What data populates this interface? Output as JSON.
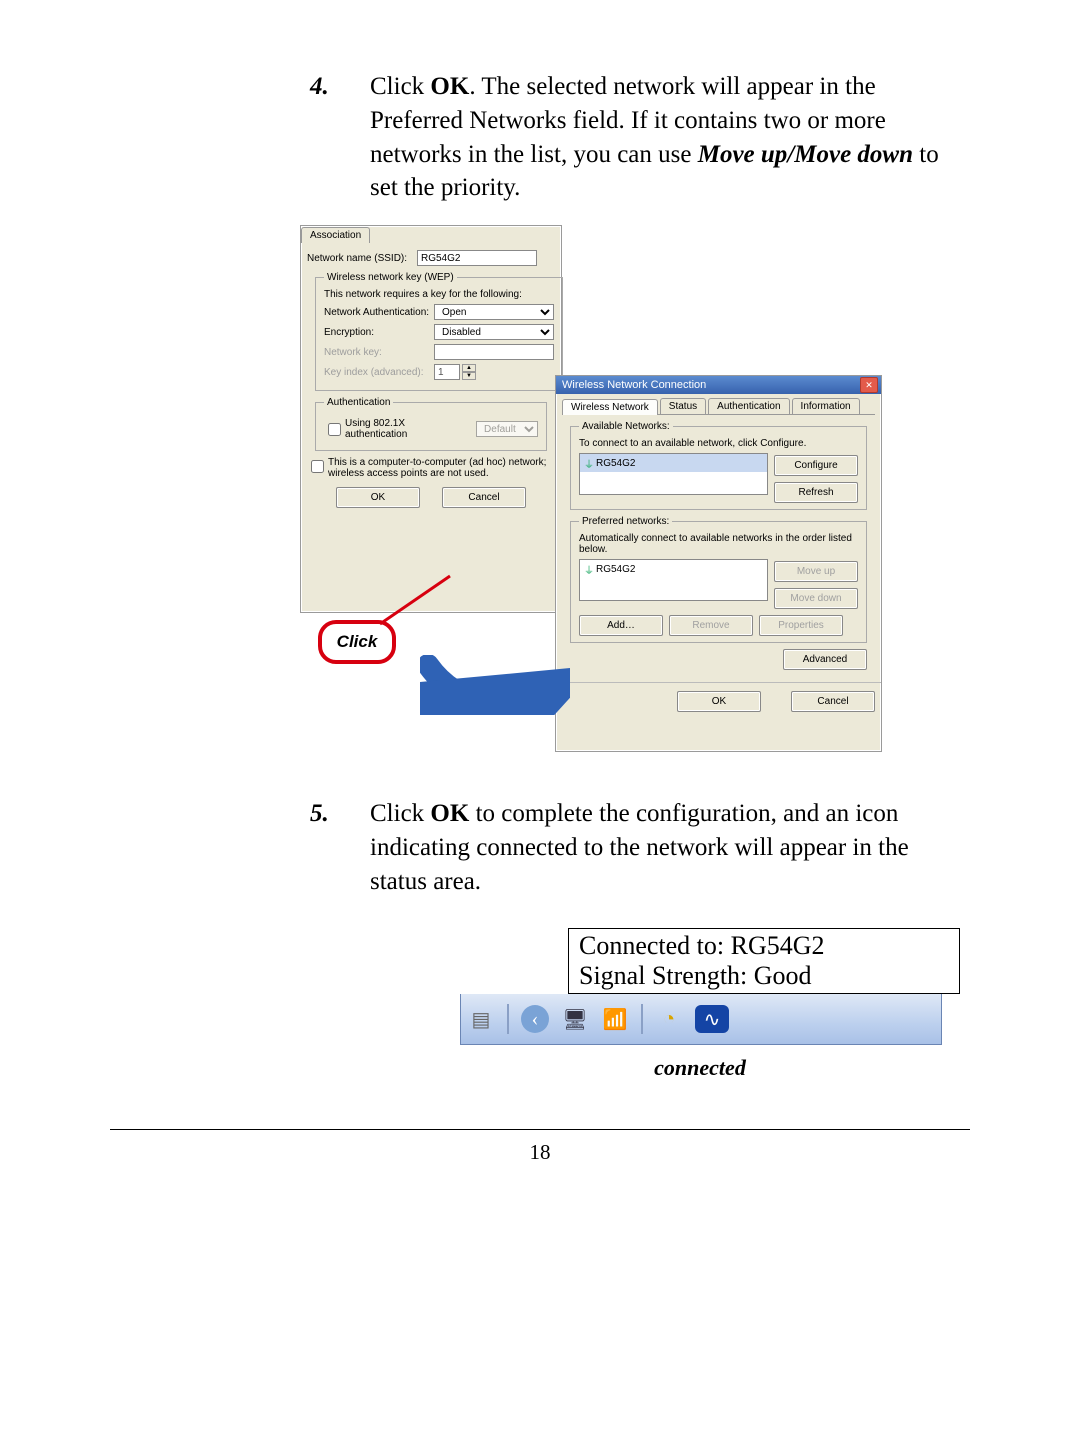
{
  "step4": {
    "num": "4.",
    "pre": "Click ",
    "kw": "OK",
    "post1": ".  The selected network will appear in the Preferred Networks field.  If it contains two or more networks in the list, you can use ",
    "kw2": "Move up",
    "sep": "/",
    "kw3": "Move down",
    "post2": " to set the priority."
  },
  "step5": {
    "num": "5.",
    "pre": "Click ",
    "kw": "OK",
    "post": " to complete the configuration, and an icon indicating connected to the network will appear in the status area."
  },
  "dlg1": {
    "tab": "Association",
    "ssid_label": "Network name (SSID):",
    "ssid_value": "RG54G2",
    "wep_group": "Wireless network key (WEP)",
    "wep_note": "This network requires a key for the following:",
    "auth_label": "Network Authentication:",
    "auth_value": "Open",
    "enc_label": "Encryption:",
    "enc_value": "Disabled",
    "key_label": "Network key:",
    "keyidx_label": "Key index (advanced):",
    "keyidx_value": "1",
    "authn_group": "Authentication",
    "use8021x": "Using 802.1X authentication",
    "eap_value": "Default",
    "adhoc": "This is a computer-to-computer (ad hoc) network; wireless access points are not used.",
    "ok": "OK",
    "cancel": "Cancel"
  },
  "dlg2": {
    "title": "Wireless Network Connection",
    "tabs": [
      "Wireless Network",
      "Status",
      "Authentication",
      "Information"
    ],
    "avail_group": "Available Networks:",
    "avail_note": "To connect to an available network, click Configure.",
    "avail_item": "RG54G2",
    "configure": "Configure",
    "refresh": "Refresh",
    "pref_group": "Preferred networks:",
    "pref_note": "Automatically connect to available networks in the order listed below.",
    "pref_item": "RG54G2",
    "moveup": "Move up",
    "movedown": "Move down",
    "add": "Add…",
    "remove": "Remove",
    "props": "Properties",
    "advanced": "Advanced",
    "ok": "OK",
    "cancel": "Cancel"
  },
  "callout": "Click",
  "tooltip": {
    "l1": "Connected to: RG54G2",
    "l2": "Signal Strength: Good"
  },
  "caption": "connected",
  "pagenum": "18",
  "colors": {
    "accent_blue": "#2f62b5",
    "callout_red": "#d7000f"
  }
}
